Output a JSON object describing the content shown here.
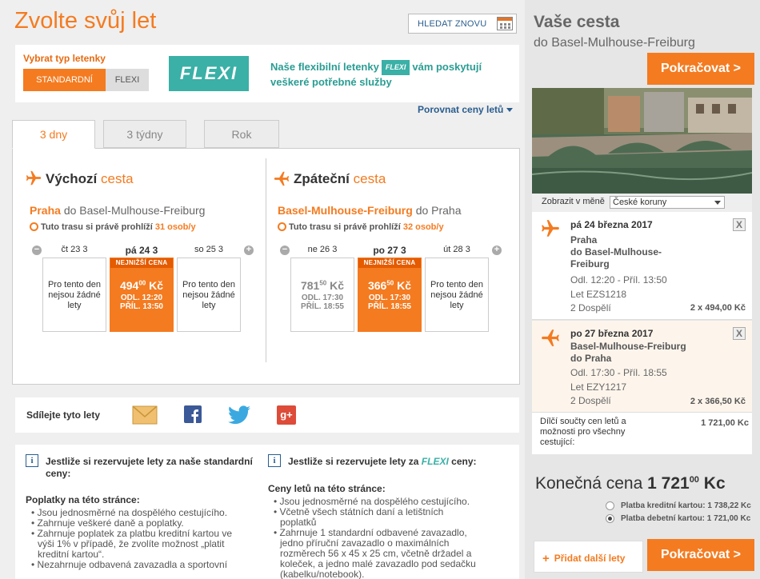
{
  "header": {
    "title": "Zvolte svůj let",
    "search_again": "HLEDAT ZNOVU"
  },
  "ticket_type": {
    "label": "Vybrat typ letenky",
    "standard": "STANDARDNÍ",
    "flexi": "FLEXI",
    "logo": "FLEXI",
    "promo_part1": "Naše flexibilní letenky",
    "promo_badge": "FLEXI",
    "promo_part2": "vám poskytují",
    "promo_line2": "veškeré potřebné služby"
  },
  "compare": "Porovnat ceny letů",
  "tabs": [
    "3 dny",
    "3 týdny",
    "Rok"
  ],
  "outbound": {
    "title_a": "Výchozí",
    "title_b": "cesta",
    "from": "Praha",
    "route_rest": "do Basel-Mulhouse-Freiburg",
    "watch_text": "Tuto trasu si právě prohlíží",
    "watch_count": "31 osob/y",
    "days": [
      {
        "label": "čt 23 3",
        "none": "Pro tento den nejsou žádné lety"
      },
      {
        "label": "pá 24 3",
        "ribbon": "NEJNIŽŠÍ CENA",
        "price": "494",
        "price_dec": "00",
        "currency": "Kč",
        "dep": "ODL. 12:20",
        "arr": "PŘÍL. 13:50"
      },
      {
        "label": "so 25 3",
        "none": "Pro tento den nejsou žádné lety"
      }
    ]
  },
  "inbound": {
    "title_a": "Zpáteční",
    "title_b": "cesta",
    "from": "Basel-Mulhouse-Freiburg",
    "route_rest": "do Praha",
    "watch_text": "Tuto trasu si právě prohlíží",
    "watch_count": "32 osob/y",
    "days": [
      {
        "label": "ne 26 3",
        "price": "781",
        "price_dec": "50",
        "currency": "Kč",
        "dep": "ODL. 17:30",
        "arr": "PŘÍL. 18:55"
      },
      {
        "label": "po 27 3",
        "ribbon": "NEJNIŽŠÍ CENA",
        "price": "366",
        "price_dec": "50",
        "currency": "Kč",
        "dep": "ODL. 17:30",
        "arr": "PŘÍL. 18:55"
      },
      {
        "label": "út 28 3",
        "none": "Pro tento den nejsou žádné lety"
      }
    ]
  },
  "share": {
    "label": "Sdílejte tyto lety",
    "gplus": "g+"
  },
  "info_standard": {
    "head1": "Jestliže si rezervujete lety za naše standardní",
    "head2": "ceny:",
    "sub": "Poplatky na této stránce:",
    "items": [
      "Jsou jednosměrné na dospělého cestujícího.",
      "Zahrnuje veškeré daně a poplatky.",
      "Zahrnuje poplatek za platbu kreditní kartou ve výši 1% v případě, že zvolíte možnost „platit kreditní kartou“.",
      "Nezahrnuje odbavená zavazadla a sportovní"
    ]
  },
  "info_flexi": {
    "head_a": "Jestliže si rezervujete lety za",
    "head_flexi": "FLEXI",
    "head_b": "ceny:",
    "sub": "Ceny letů na této stránce:",
    "items": [
      "Jsou jednosměrné na dospělého cestujícího.",
      "Včetně všech státních daní a letištních poplatků",
      "Zahrnuje 1 standardní odbavené zavazadlo, jedno příruční zavazadlo o maximálních rozměrech 56 x 45 x 25 cm, včetně držadel a koleček, a jedno malé zavazadlo pod sedačku (kabelku/notebook)."
    ]
  },
  "sidebar": {
    "title": "Vaše cesta",
    "destination": "do Basel-Mulhouse-Freiburg",
    "continue": "Pokračovat >",
    "currency_label": "Zobrazit v měně",
    "currency_value": "České koruny",
    "legs": [
      {
        "date": "pá 24 března 2017",
        "place1": "Praha",
        "place2": "do Basel-Mulhouse-",
        "place3": "Freiburg",
        "times": "Odl. 12:20 - Příl. 13:50",
        "flight": "Let EZS1218",
        "pax": "2 Dospělí",
        "amount": "2 x 494,00 Kč",
        "remove": "X"
      },
      {
        "date": "po 27 března 2017",
        "place1": "Basel-Mulhouse-Freiburg",
        "place2": "do Praha",
        "times": "Odl. 17:30 - Příl. 18:55",
        "flight": "Let EZY1217",
        "pax": "2 Dospělí",
        "amount": "2 x 366,50 Kč",
        "remove": "X"
      }
    ],
    "subtotal_label": "Dílčí součty cen letů a možnosti pro všechny cestující:",
    "subtotal_value": "1 721,00 Kc",
    "final_label": "Konečná cena",
    "final_int": "1 721",
    "final_dec": "00",
    "final_cur": "Kc",
    "pay_credit": "Platba kreditní kartou: 1 738,22 Kc",
    "pay_debit": "Platba debetní kartou: 1 721,00 Kc",
    "add_flights": "Přidat další lety",
    "add_plus": "+",
    "continue2": "Pokračovat >"
  },
  "colors": {
    "accent": "#f47b20",
    "flexi": "#3ab0a6",
    "link": "#2a5d8f"
  }
}
